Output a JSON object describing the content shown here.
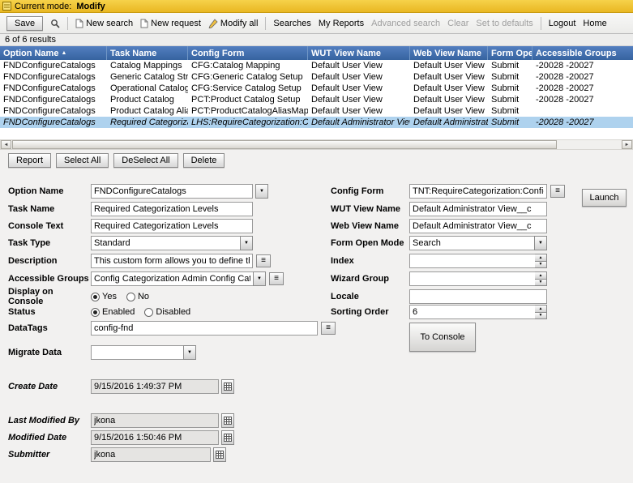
{
  "colors": {
    "header_blue": "#3f6ca8",
    "selected_row": "#aed2ee",
    "mode_bar_yellow": "#edbd29"
  },
  "mode_bar": {
    "prefix": "Current mode:",
    "mode": "Modify"
  },
  "toolbar": {
    "save": "Save",
    "new_search": "New search",
    "new_request": "New request",
    "modify_all": "Modify all",
    "searches": "Searches",
    "my_reports": "My Reports",
    "advanced_search": "Advanced search",
    "clear": "Clear",
    "set_to_defaults": "Set to defaults",
    "logout": "Logout",
    "home": "Home"
  },
  "results_bar": {
    "text": "6 of 6 results"
  },
  "table": {
    "columns": [
      {
        "label": "Option Name",
        "sorted": true
      },
      {
        "label": "Task Name"
      },
      {
        "label": "Config Form"
      },
      {
        "label": "WUT View Name"
      },
      {
        "label": "Web View Name"
      },
      {
        "label": "Form Ope..."
      },
      {
        "label": "Accessible Groups"
      }
    ],
    "selected_row_index": 5,
    "rows": [
      {
        "option_name": "FNDConfigureCatalogs",
        "task_name": "Catalog Mappings",
        "config_form": "CFG:Catalog Mapping",
        "wut_view_name": "Default User View",
        "web_view_name": "Default User View",
        "form_open_mode": "Submit",
        "accessible_groups": "-20028 -20027"
      },
      {
        "option_name": "FNDConfigureCatalogs",
        "task_name": "Generic Catalog Struc",
        "config_form": "CFG:Generic Catalog Setup",
        "wut_view_name": "Default User View",
        "web_view_name": "Default User View",
        "form_open_mode": "Submit",
        "accessible_groups": "-20028 -20027"
      },
      {
        "option_name": "FNDConfigureCatalogs",
        "task_name": "Operational Catalog",
        "config_form": "CFG:Service Catalog Setup",
        "wut_view_name": "Default User View",
        "web_view_name": "Default User View",
        "form_open_mode": "Submit",
        "accessible_groups": "-20028 -20027"
      },
      {
        "option_name": "FNDConfigureCatalogs",
        "task_name": "Product Catalog",
        "config_form": "PCT:Product Catalog Setup",
        "wut_view_name": "Default User View",
        "web_view_name": "Default User View",
        "form_open_mode": "Submit",
        "accessible_groups": "-20028 -20027"
      },
      {
        "option_name": "FNDConfigureCatalogs",
        "task_name": "Product Catalog Alias",
        "config_form": "PCT:ProductCatalogAliasMappingFor",
        "wut_view_name": "Default User View",
        "web_view_name": "Default User View",
        "form_open_mode": "Submit",
        "accessible_groups": ""
      },
      {
        "option_name": "FNDConfigureCatalogs",
        "task_name": "Required Categorizati",
        "config_form": "LHS:RequireCategorization:Config",
        "wut_view_name": "Default Administrator View__",
        "web_view_name": "Default Administrator",
        "form_open_mode": "Submit",
        "accessible_groups": "-20028 -20027"
      }
    ]
  },
  "actions": {
    "report": "Report",
    "select_all": "Select All",
    "deselect_all": "DeSelect All",
    "delete": "Delete"
  },
  "form": {
    "option_name": {
      "label": "Option Name",
      "value": "FNDConfigureCatalogs"
    },
    "task_name": {
      "label": "Task Name",
      "value": "Required Categorization Levels"
    },
    "console_text": {
      "label": "Console Text",
      "value": "Required Categorization Levels"
    },
    "task_type": {
      "label": "Task Type",
      "value": "Standard"
    },
    "description": {
      "label": "Description",
      "value": "This custom form allows you to define the minin"
    },
    "accessible_groups": {
      "label": "Accessible Groups",
      "value": "Config Categorization Admin Config Categorizat"
    },
    "display_on_console": {
      "label": "Display on Console",
      "options": [
        "Yes",
        "No"
      ],
      "selected": "Yes"
    },
    "status": {
      "label": "Status",
      "options": [
        "Enabled",
        "Disabled"
      ],
      "selected": "Enabled"
    },
    "datatags": {
      "label": "DataTags",
      "value": "config-fnd"
    },
    "migrate_data": {
      "label": "Migrate Data",
      "value": ""
    },
    "create_date": {
      "label": "Create Date",
      "value": "9/15/2016 1:49:37 PM"
    },
    "last_modified_by": {
      "label": "Last Modified By",
      "value": "jkona"
    },
    "modified_date": {
      "label": "Modified Date",
      "value": "9/15/2016 1:50:46 PM"
    },
    "submitter": {
      "label": "Submitter",
      "value": "jkona"
    },
    "config_form": {
      "label": "Config Form",
      "value": "TNT:RequireCategorization:Config"
    },
    "wut_view_name": {
      "label": "WUT View Name",
      "value": "Default Administrator View__c"
    },
    "web_view_name": {
      "label": "Web View Name",
      "value": "Default Administrator View__c"
    },
    "form_open_mode": {
      "label": "Form Open Mode",
      "value": "Search"
    },
    "index": {
      "label": "Index",
      "value": ""
    },
    "wizard_group": {
      "label": "Wizard Group",
      "value": ""
    },
    "locale": {
      "label": "Locale",
      "value": ""
    },
    "sorting_order": {
      "label": "Sorting Order",
      "value": "6"
    },
    "launch": "Launch",
    "to_console": "To Console"
  }
}
